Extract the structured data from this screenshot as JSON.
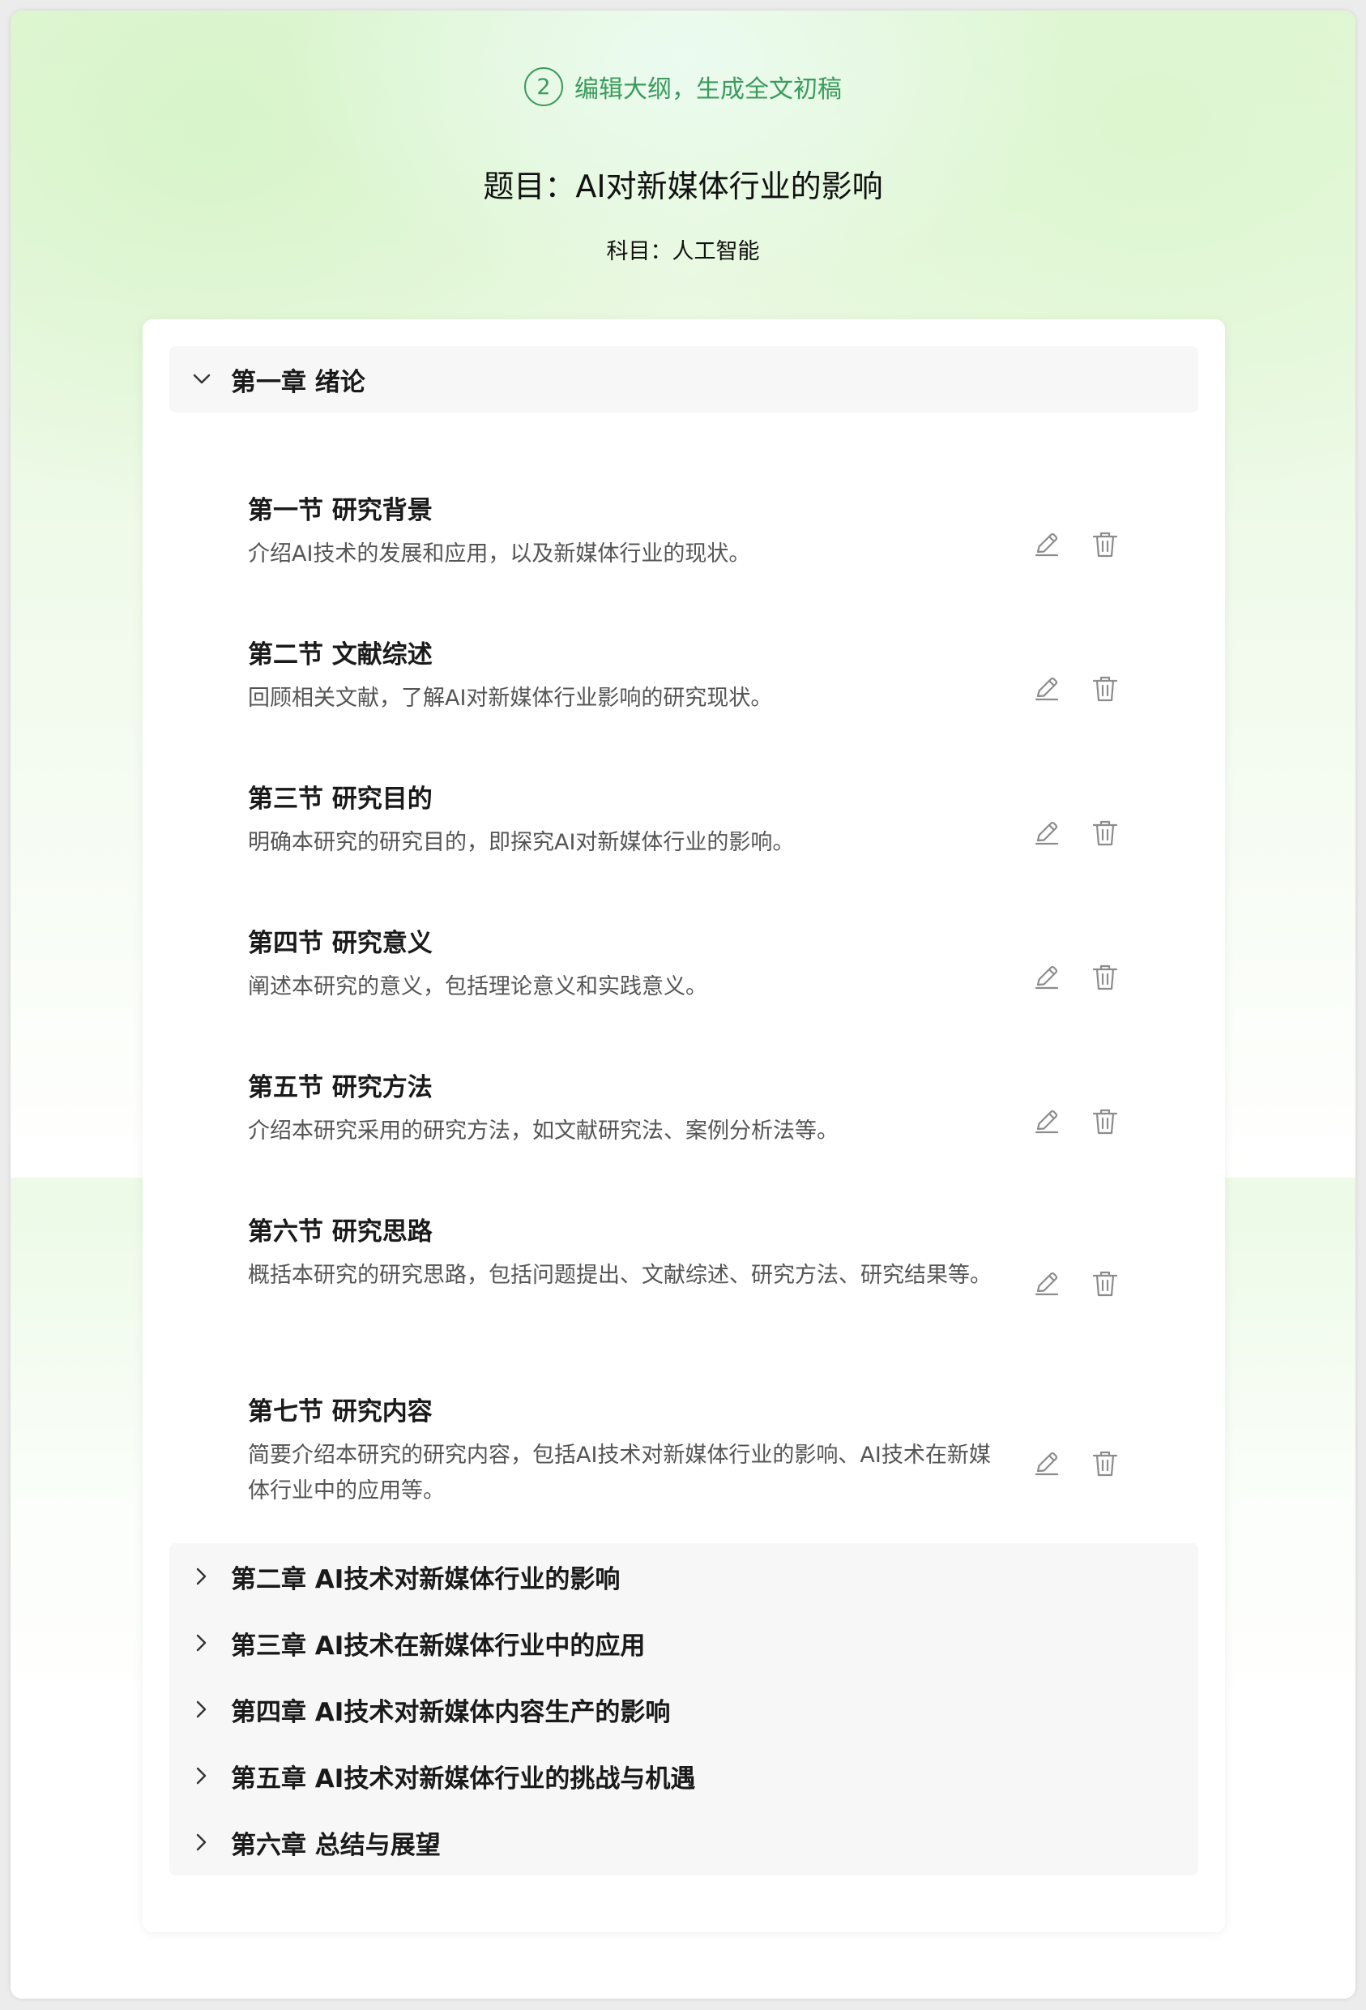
{
  "header": {
    "step_number": "2",
    "step_label": "编辑大纲，生成全文初稿",
    "title": "题目：AI对新媒体行业的影响",
    "subject": "科目：人工智能"
  },
  "outline": {
    "expanded_chapter": {
      "label": "第一章 绪论",
      "sections": [
        {
          "title": "第一节 研究背景",
          "desc": "介绍AI技术的发展和应用，以及新媒体行业的现状。"
        },
        {
          "title": "第二节 文献综述",
          "desc": "回顾相关文献，了解AI对新媒体行业影响的研究现状。"
        },
        {
          "title": "第三节 研究目的",
          "desc": "明确本研究的研究目的，即探究AI对新媒体行业的影响。"
        },
        {
          "title": "第四节 研究意义",
          "desc": "阐述本研究的意义，包括理论意义和实践意义。"
        },
        {
          "title": "第五节 研究方法",
          "desc": "介绍本研究采用的研究方法，如文献研究法、案例分析法等。"
        },
        {
          "title": "第六节 研究思路",
          "desc": "概括本研究的研究思路，包括问题提出、文献综述、研究方法、研究结果等。"
        },
        {
          "title": "第七节 研究内容",
          "desc": "简要介绍本研究的研究内容，包括AI技术对新媒体行业的影响、AI技术在新媒体行业中的应用等。"
        }
      ]
    },
    "collapsed_chapters": [
      {
        "label": "第二章 AI技术对新媒体行业的影响"
      },
      {
        "label": "第三章 AI技术在新媒体行业中的应用"
      },
      {
        "label": "第四章 AI技术对新媒体内容生产的影响"
      },
      {
        "label": "第五章 AI技术对新媒体行业的挑战与机遇"
      },
      {
        "label": "第六章 总结与展望"
      }
    ]
  },
  "icons": {
    "edit": "pencil-icon",
    "delete": "trash-icon",
    "expanded": "chevron-down-icon",
    "collapsed": "chevron-right-icon"
  },
  "colors": {
    "accent": "#3a9b5c",
    "icon": "#8c8c8c",
    "panel": "#f7f7f7"
  }
}
